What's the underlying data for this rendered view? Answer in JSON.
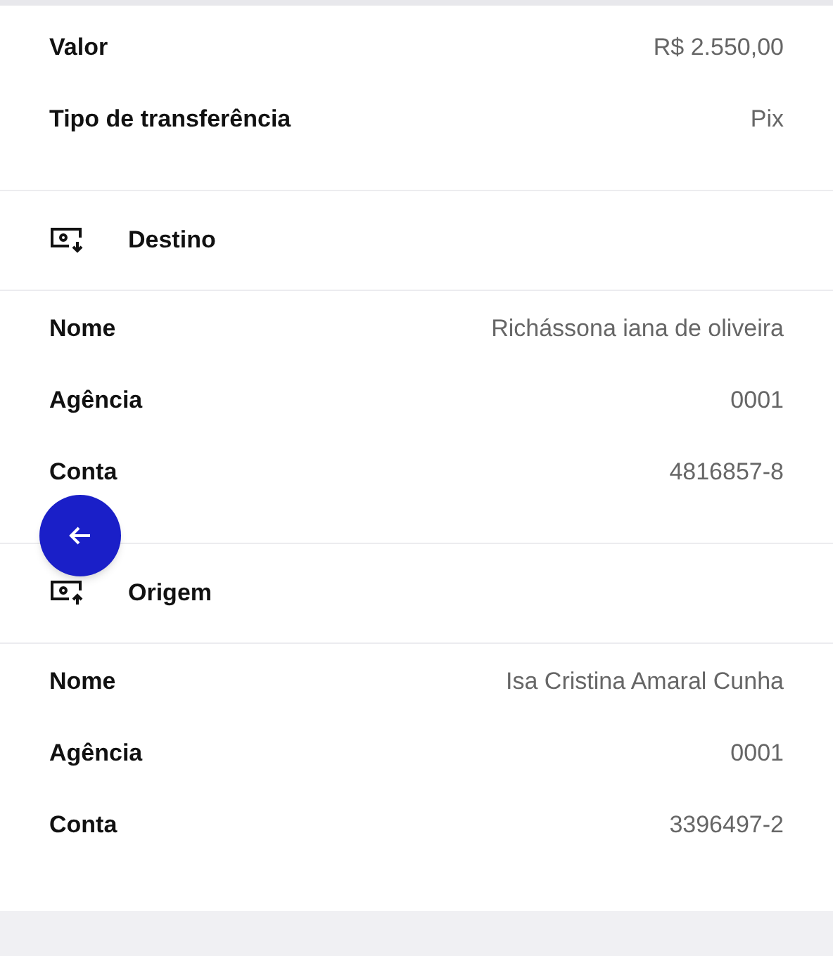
{
  "sections": [
    {
      "rows": [
        {
          "label": "Valor",
          "value": "R$ 2.550,00"
        },
        {
          "label": "Tipo de transferência",
          "value": "Pix"
        }
      ]
    },
    {
      "title": "Destino",
      "kind": "incoming",
      "rows": [
        {
          "label": "Nome",
          "value": "Richássona iana de oliveira"
        },
        {
          "label": "Agência",
          "value": "0001"
        },
        {
          "label": "Conta",
          "value": "4816857-8"
        }
      ]
    },
    {
      "title": "Origem",
      "kind": "outgoing",
      "rows": [
        {
          "label": "Nome",
          "value": "Isa Cristina Amaral Cunha"
        },
        {
          "label": "Agência",
          "value": "0001"
        },
        {
          "label": "Conta",
          "value": "3396497-2"
        }
      ]
    }
  ]
}
